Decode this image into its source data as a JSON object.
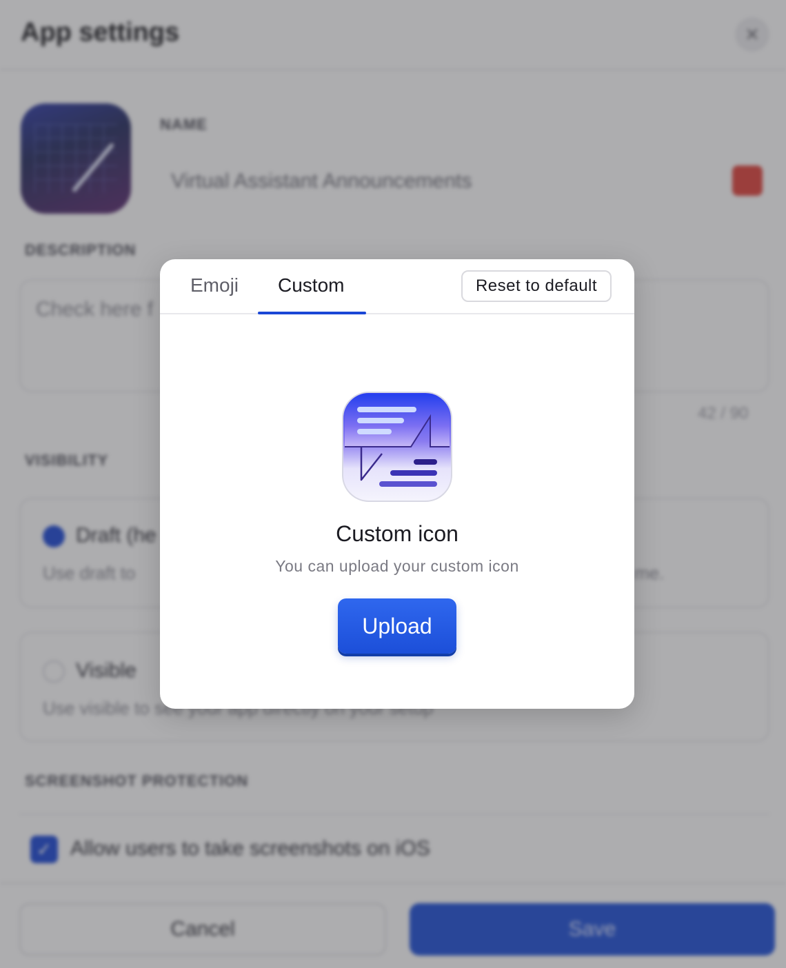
{
  "background": {
    "title": "App settings",
    "close_glyph": "✕",
    "name_label": "NAME",
    "name_value": "Virtual Assistant Announcements",
    "description_label": "DESCRIPTION",
    "description_value": "Check here f",
    "description_count": "42 / 90",
    "visibility_label": "VISIBILITY",
    "draft_option_title": "Draft (he",
    "draft_option_desc": "Use draft to",
    "draft_option_desc_tail": "me.",
    "visible_option_title": "Visible",
    "visible_option_desc": "Use visible to see your app directly on your setup",
    "screenshot_label": "SCREENSHOT PROTECTION",
    "screenshot_checkbox_label": "Allow users to take screenshots on iOS",
    "check_glyph": "✓",
    "cancel_label": "Cancel",
    "save_label": "Save"
  },
  "modal": {
    "tabs": [
      {
        "label": "Emoji",
        "active": false
      },
      {
        "label": "Custom",
        "active": true
      }
    ],
    "reset_label": "Reset to default",
    "icon_name": "custom-app-icon",
    "heading": "Custom icon",
    "subtext": "You can upload your custom icon",
    "upload_label": "Upload"
  },
  "colors": {
    "accent": "#1a47d6",
    "upload_button": "#1c4fd9",
    "danger_badge": "#e0413a"
  }
}
